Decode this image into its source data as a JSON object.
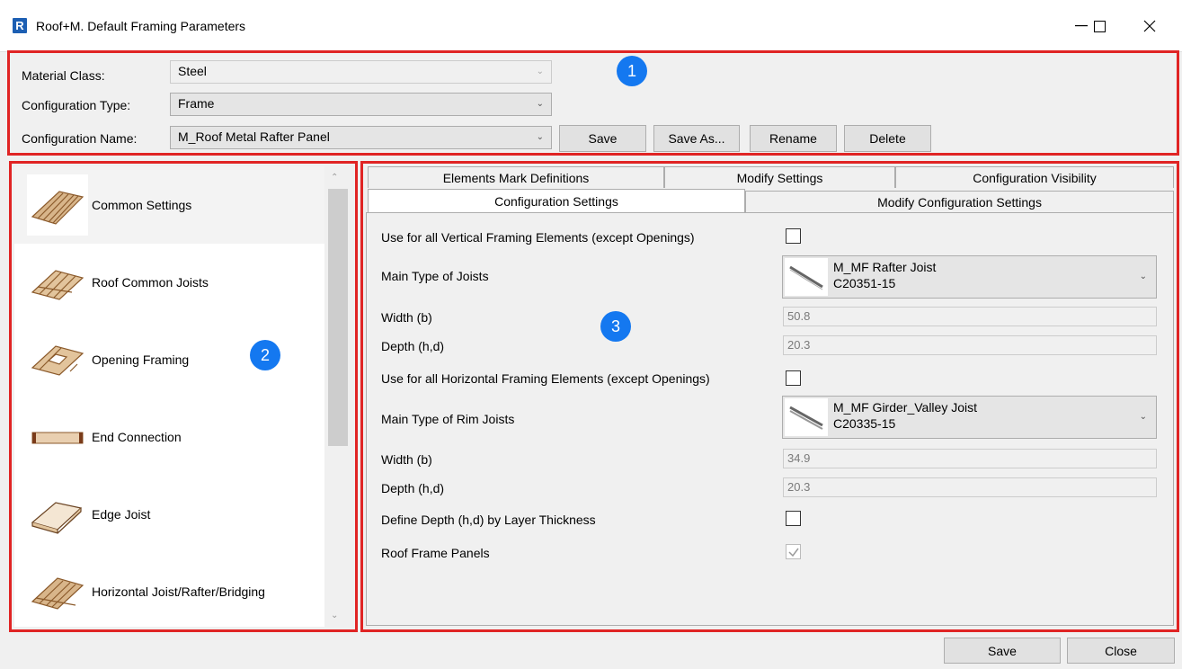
{
  "window": {
    "title": "Roof+M. Default Framing Parameters",
    "logo_letter": "R",
    "minimize": "—",
    "maximize": "☐",
    "close": "✕"
  },
  "config": {
    "material_class_label": "Material Class:",
    "material_class_value": "Steel",
    "configuration_type_label": "Configuration Type:",
    "configuration_type_value": "Frame",
    "configuration_name_label": "Configuration Name:",
    "configuration_name_value": "M_Roof Metal Rafter Panel",
    "buttons": {
      "save": "Save",
      "save_as": "Save As...",
      "rename": "Rename",
      "delete": "Delete"
    }
  },
  "badges": {
    "one": "1",
    "two": "2",
    "three": "3"
  },
  "sidebar": {
    "items": [
      {
        "label": "Common Settings",
        "icon": "floor-joists-icon"
      },
      {
        "label": "Roof Common Joists",
        "icon": "roof-joists-icon"
      },
      {
        "label": "Opening Framing",
        "icon": "opening-framing-icon"
      },
      {
        "label": "End Connection",
        "icon": "end-connection-icon"
      },
      {
        "label": "Edge Joist",
        "icon": "edge-joist-icon"
      },
      {
        "label": "Horizontal Joist/Rafter/Bridging",
        "icon": "horizontal-joist-icon"
      }
    ]
  },
  "tabs": {
    "row1": [
      "Elements Mark Definitions",
      "Modify Settings",
      "Configuration Visibility"
    ],
    "row2": [
      "Configuration Settings",
      "Modify Configuration Settings"
    ]
  },
  "settings": {
    "vertical_label": "Use for all Vertical Framing Elements (except Openings)",
    "main_joists_label": "Main Type of Joists",
    "main_joists_name": "M_MF Rafter Joist",
    "main_joists_code": "C20351-15",
    "width1_label": "Width (b)",
    "width1_value": "50.8",
    "depth1_label": "Depth (h,d)",
    "depth1_value": "20.3",
    "horizontal_label": "Use for all Horizontal Framing Elements (except Openings)",
    "rim_joists_label": "Main Type of Rim Joists",
    "rim_joists_name": "M_MF Girder_Valley Joist",
    "rim_joists_code": "C20335-15",
    "width2_label": "Width (b)",
    "width2_value": "34.9",
    "depth2_label": "Depth (h,d)",
    "depth2_value": "20.3",
    "layer_thickness_label": "Define Depth (h,d) by Layer Thickness",
    "roof_panels_label": "Roof Frame Panels"
  },
  "footer": {
    "save": "Save",
    "close": "Close"
  }
}
